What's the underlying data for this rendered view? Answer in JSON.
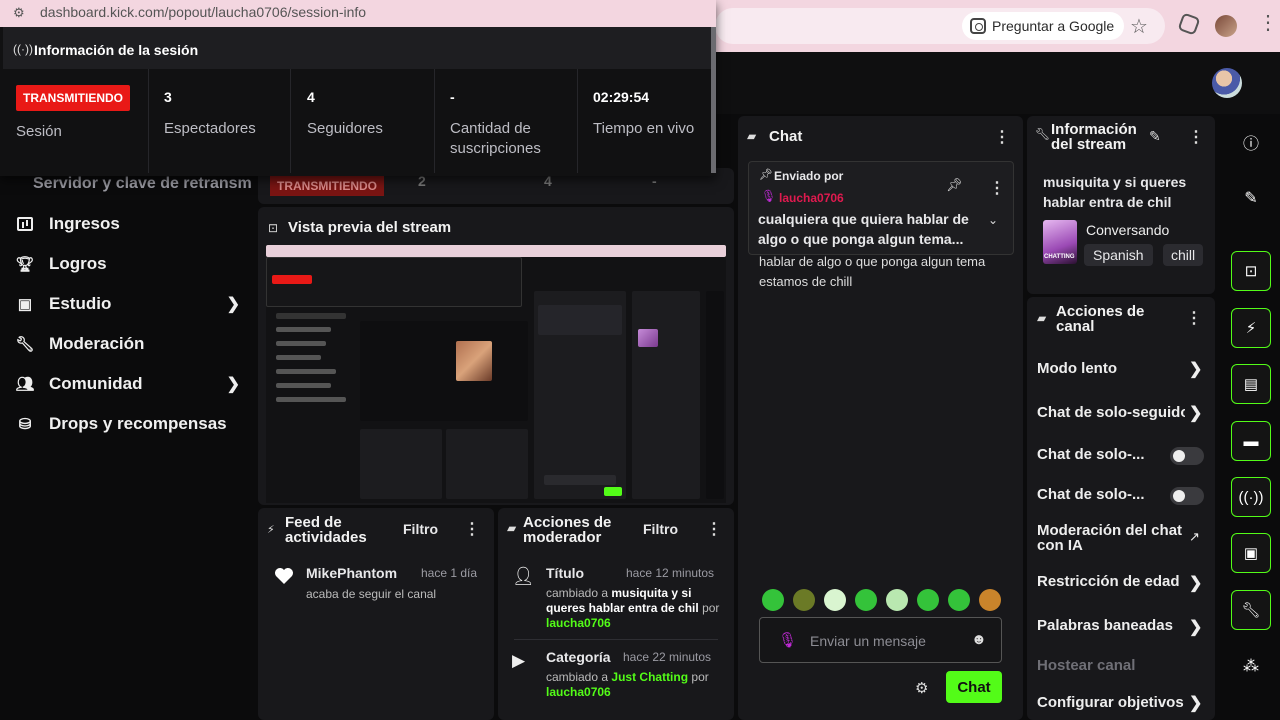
{
  "browser": {
    "popup_url": "dashboard.kick.com/popout/laucha0706/session-info",
    "ask_google": "Preguntar a Google"
  },
  "session": {
    "title": "Información de la sesión",
    "live_badge": "TRANSMITIENDO",
    "stats": [
      {
        "value": "",
        "label": "Sesión"
      },
      {
        "value": "3",
        "label": "Espectadores"
      },
      {
        "value": "4",
        "label": "Seguidores"
      },
      {
        "value": "-",
        "label": "Cantidad de suscripciones"
      },
      {
        "value": "02:29:54",
        "label": "Tiempo en vivo"
      }
    ]
  },
  "behind_row": {
    "server_key": "Servidor y clave de retransm",
    "badge": "TRANSMITIENDO",
    "v1": "2",
    "v2": "4",
    "v3": "-"
  },
  "sidebar": {
    "items": [
      {
        "label": "Ingresos",
        "icon": "chart-icon"
      },
      {
        "label": "Logros",
        "icon": "trophy-icon"
      },
      {
        "label": "Estudio",
        "icon": "studio-icon"
      },
      {
        "label": "Moderación",
        "icon": "wrench-icon"
      },
      {
        "label": "Comunidad",
        "icon": "community-icon"
      },
      {
        "label": "Drops y recompensas",
        "icon": "drops-icon"
      }
    ]
  },
  "preview": {
    "title": "Vista previa del stream"
  },
  "activity": {
    "title": "Feed de actividades",
    "filter": "Filtro",
    "items": [
      {
        "user": "MikePhantom",
        "time": "hace 1 día",
        "text": "acaba de seguir el canal"
      }
    ]
  },
  "mod_actions": {
    "title": "Acciones de moderador",
    "filter": "Filtro",
    "items": [
      {
        "kind": "Título",
        "time": "hace 12 minutos",
        "pre": "cambiado a",
        "value": "musiquita y si queres hablar entra de chil",
        "by": "por",
        "user": "laucha0706"
      },
      {
        "kind": "Categoría",
        "time": "hace 22 minutos",
        "pre": "cambiado a",
        "value": "Just Chatting",
        "by": "por",
        "user": "laucha0706"
      }
    ]
  },
  "chat": {
    "title": "Chat",
    "pinned_label": "Enviado por",
    "pinned_user": "laucha0706",
    "pinned_text": "cualquiera que quiera hablar de algo o que ponga algun tema...",
    "message_tail": "hablar de algo o que ponga algun tema estamos de chill",
    "input_placeholder": "Enviar un mensaje",
    "send": "Chat"
  },
  "stream_info": {
    "title": "Información del stream",
    "stream_title": "musiquita y si queres hablar entra de chil",
    "category": "Conversando",
    "thumb_text": "CHATTING",
    "tags": [
      "Spanish",
      "chill"
    ]
  },
  "channel_actions": {
    "title": "Acciones de canal",
    "items": [
      {
        "label": "Modo lento",
        "type": "chevron"
      },
      {
        "label": "Chat de solo-seguido",
        "type": "chevron"
      },
      {
        "label": "Chat de solo-...",
        "type": "toggle"
      },
      {
        "label": "Chat de solo-...",
        "type": "toggle"
      },
      {
        "label": "Moderación del chat con IA",
        "type": "external"
      },
      {
        "label": "Restricción de edad",
        "type": "chevron"
      },
      {
        "label": "Palabras baneadas",
        "type": "chevron"
      },
      {
        "label": "Hostear canal",
        "type": "disabled"
      },
      {
        "label": "Configurar objetivos",
        "type": "chevron"
      }
    ]
  },
  "colors": {
    "accent": "#53fc18",
    "live": "#e91916",
    "panel": "#18181b"
  }
}
